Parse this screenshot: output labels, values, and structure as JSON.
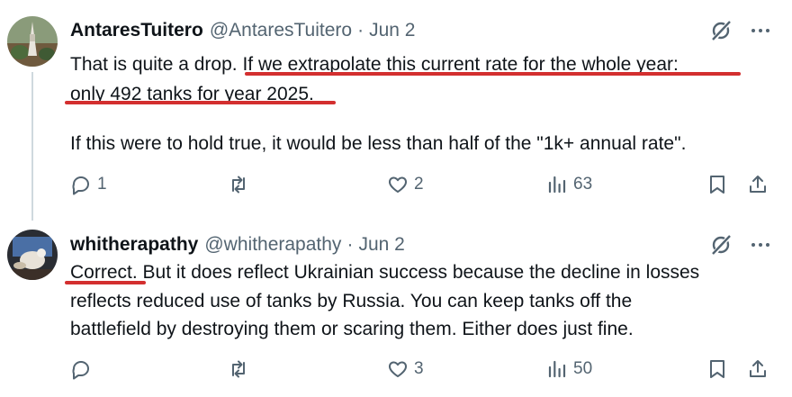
{
  "tweets": [
    {
      "display_name": "AntaresTuitero",
      "handle": "@AntaresTuitero",
      "separator": "·",
      "date": "Jun 2",
      "text_line1_a": "That is quite a drop",
      "text_line1_b": ". If we extrapolate this current rate for the whole year:",
      "text_line2": "only 492 tanks for year 2025.",
      "text_line3": "If this were to hold true, it would be less than half of the \"1k+ annual rate\".",
      "replies": "1",
      "reposts": "",
      "likes": "2",
      "views": "63"
    },
    {
      "display_name": "whitherapathy",
      "handle": "@whitherapathy",
      "separator": "·",
      "date": "Jun 2",
      "text_line1_a": "Correct.",
      "text_line1_b": " But it does reflect Ukrainian success because the decline in losses",
      "text_line2": "reflects reduced use of tanks by Russia. You can keep tanks off the",
      "text_line3": "battlefield by destroying them or scaring them. Either does just fine.",
      "replies": "",
      "reposts": "",
      "likes": "3",
      "views": "50"
    }
  ],
  "colors": {
    "underline": "#d32f2f",
    "secondary": "#536471",
    "text": "#0f1419"
  }
}
